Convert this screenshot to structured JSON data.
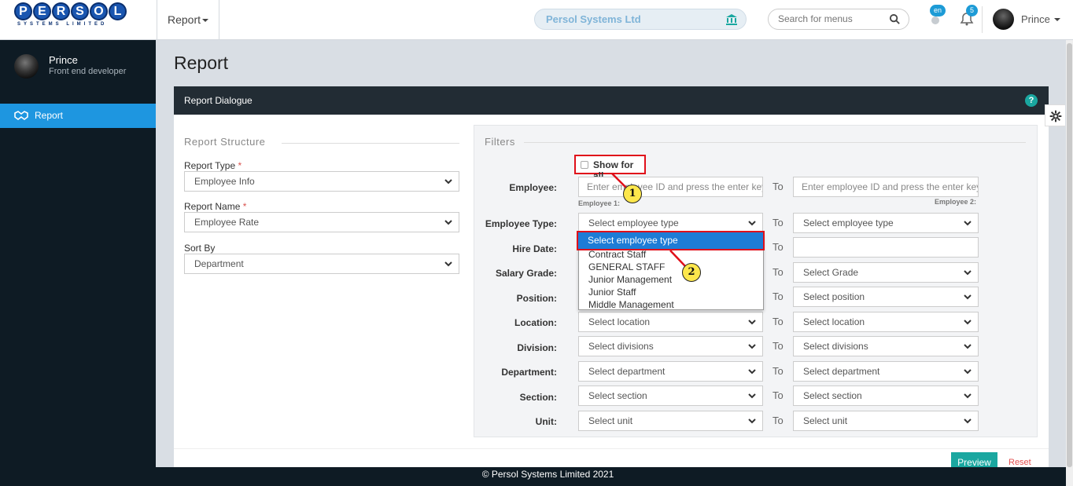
{
  "header": {
    "logo_text": "PERSOL",
    "logo_letters": [
      "P",
      "E",
      "R",
      "S",
      "O",
      "L"
    ],
    "logo_sub": "SYSTEMS LIMITED",
    "report_menu": "Report",
    "company": "Persol Systems Ltd",
    "search_placeholder": "Search for menus",
    "lang_badge": "en",
    "notif_badge": "5",
    "user_name": "Prince"
  },
  "sidebar": {
    "user_name": "Prince",
    "user_role": "Front end developer",
    "items": [
      {
        "label": "Report",
        "icon": "handshake-icon",
        "active": true
      }
    ]
  },
  "page": {
    "title": "Report"
  },
  "dialog": {
    "title": "Report Dialogue",
    "help": "?",
    "structure": {
      "legend": "Report Structure",
      "report_type_label": "Report Type",
      "report_type_value": "Employee Info",
      "report_name_label": "Report Name",
      "report_name_value": "Employee Rate",
      "sort_by_label": "Sort By",
      "sort_by_value": "Department",
      "required_mark": "*"
    },
    "filters": {
      "legend": "Filters",
      "show_all": "Show for all",
      "to": "To",
      "employee_label": "Employee:",
      "employee_placeholder": "Enter employee ID and press the enter key",
      "employee1_hint": "Employee 1:",
      "employee2_hint": "Employee 2:",
      "rows": [
        {
          "label": "Employee Type:",
          "from": "Select employee type",
          "to": "Select employee type"
        },
        {
          "label": "Hire Date:",
          "from": "",
          "to": ""
        },
        {
          "label": "Salary Grade:",
          "from": "",
          "to": "Select Grade"
        },
        {
          "label": "Position:",
          "from": "",
          "to": "Select position"
        },
        {
          "label": "Location:",
          "from": "Select location",
          "to": "Select location"
        },
        {
          "label": "Division:",
          "from": "Select divisions",
          "to": "Select divisions"
        },
        {
          "label": "Department:",
          "from": "Select department",
          "to": "Select department"
        },
        {
          "label": "Section:",
          "from": "Select section",
          "to": "Select section"
        },
        {
          "label": "Unit:",
          "from": "Select unit",
          "to": "Select unit"
        }
      ],
      "dropdown_options": [
        "Select employee type",
        "Contract Staff",
        "GENERAL STAFF",
        "Junior Management",
        "Junior Staff",
        "Middle Management"
      ]
    },
    "preview": "Preview",
    "reset": "Reset"
  },
  "callouts": [
    "1",
    "2"
  ],
  "footer": "© Persol Systems Limited 2021",
  "colors": {
    "accent": "#1e96e0",
    "sidebar": "#0e1b24",
    "highlight": "#e0101a",
    "teal": "#1aa7a0"
  }
}
